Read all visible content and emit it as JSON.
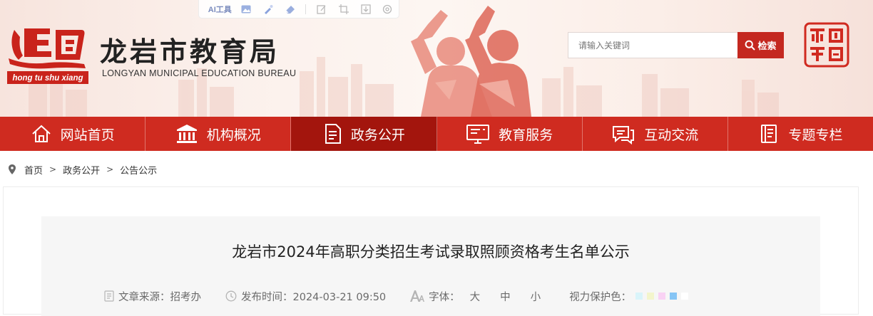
{
  "toolbar": {
    "ai_label": "AI工具",
    "icons": [
      "image-icon",
      "brush-icon",
      "eraser-icon",
      "edit-icon",
      "crop-icon",
      "download-icon",
      "settings-icon"
    ]
  },
  "header": {
    "logo_caption": "hong tu shu xiang",
    "site_title": "龙岩市教育局",
    "site_subtitle": "LONGYAN MUNICIPAL EDUCATION BUREAU",
    "search": {
      "placeholder": "请输入关键词",
      "button_label": "检索"
    }
  },
  "nav": {
    "items": [
      {
        "label": "网站首页",
        "icon": "home-icon",
        "active": false
      },
      {
        "label": "机构概况",
        "icon": "building-icon",
        "active": false
      },
      {
        "label": "政务公开",
        "icon": "document-icon",
        "active": true
      },
      {
        "label": "教育服务",
        "icon": "monitor-icon",
        "active": false
      },
      {
        "label": "互动交流",
        "icon": "chat-icon",
        "active": false
      },
      {
        "label": "专题专栏",
        "icon": "book-icon",
        "active": false
      }
    ]
  },
  "breadcrumb": {
    "items": [
      "首页",
      "政务公开",
      "公告公示"
    ],
    "separator": ">"
  },
  "article": {
    "title": "龙岩市2024年高职分类招生考试录取照顾资格考生名单公示",
    "source_label": "文章来源：招考办",
    "time_label": "发布时间：2024-03-21 09:50",
    "font_label": "字体：",
    "font_sizes": [
      "大",
      "中",
      "小"
    ],
    "eye_label": "视力保护色：",
    "eye_colors": [
      "#d9f4fa",
      "#f3f5cc",
      "#f9d2f4",
      "#86c5f5",
      "#ffffff"
    ]
  },
  "colors": {
    "brand_red": "#cf2b20",
    "nav_active": "#a3150d",
    "search_button": "#c42820"
  }
}
